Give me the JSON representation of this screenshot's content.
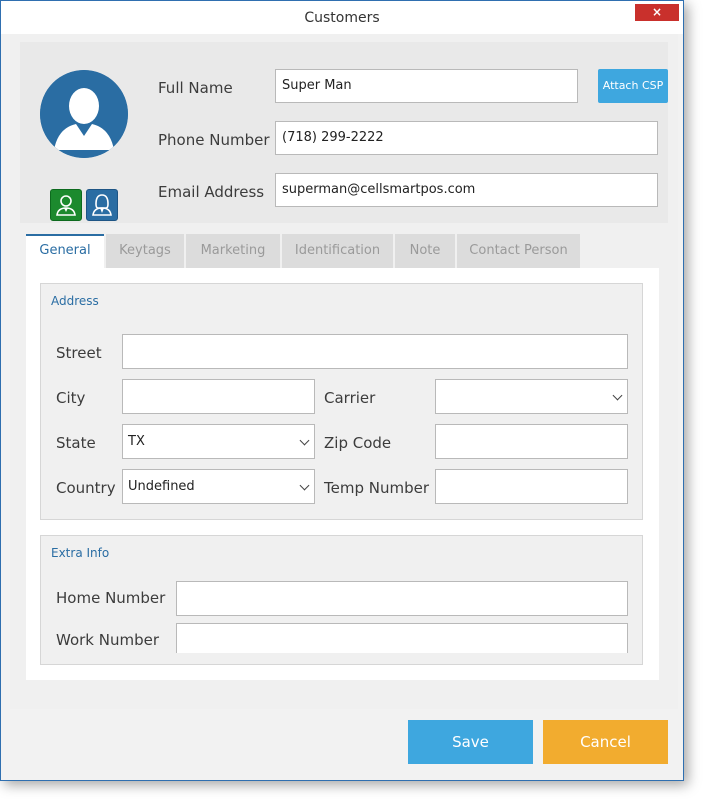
{
  "window": {
    "title": "Customers",
    "close_label": "×"
  },
  "customer": {
    "full_name_label": "Full Name",
    "full_name": "Super Man",
    "attach_csp_label": "Attach CSP",
    "phone_label": "Phone Number",
    "phone": "(718) 299-2222",
    "email_label": "Email Address",
    "email": "superman@cellsmartpos.com",
    "icons": [
      "avatar-icon",
      "male-icon",
      "female-icon"
    ]
  },
  "tabs": [
    {
      "label": "General"
    },
    {
      "label": "Keytags"
    },
    {
      "label": "Marketing"
    },
    {
      "label": "Identification"
    },
    {
      "label": "Note"
    },
    {
      "label": "Contact Person"
    }
  ],
  "address": {
    "title": "Address",
    "street_label": "Street",
    "street": "",
    "city_label": "City",
    "city": "",
    "carrier_label": "Carrier",
    "carrier": "",
    "state_label": "State",
    "state": "TX",
    "zip_label": "Zip Code",
    "zip": "",
    "country_label": "Country",
    "country": "Undefined",
    "temp_label": "Temp Number",
    "temp": ""
  },
  "extra": {
    "title": "Extra Info",
    "home_label": "Home Number",
    "home": "",
    "work_label": "Work Number",
    "work": ""
  },
  "footer": {
    "save_label": "Save",
    "cancel_label": "Cancel"
  },
  "colors": {
    "accent": "#2a6da3",
    "save": "#3ea7df",
    "cancel": "#f2ac2f",
    "close": "#c9302c",
    "male": "#1c8a2e"
  }
}
